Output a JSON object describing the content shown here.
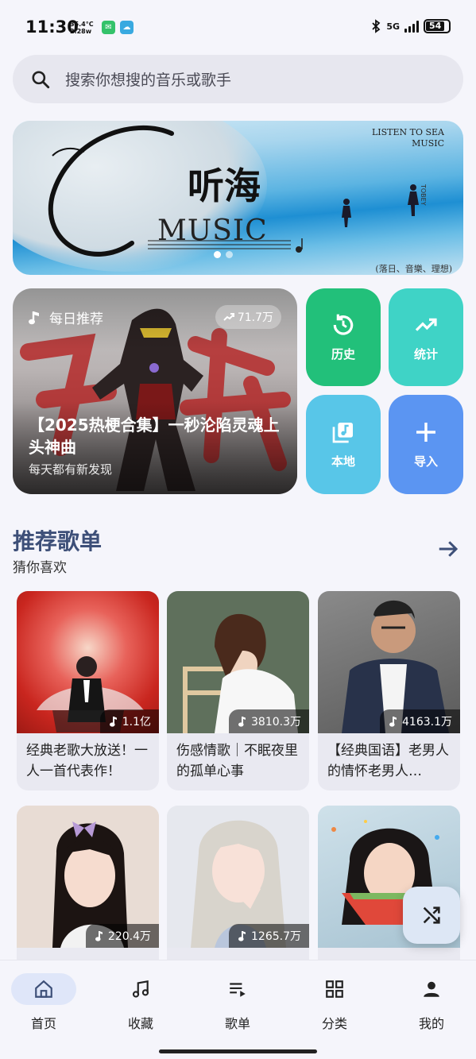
{
  "status_bar": {
    "time": "11:30",
    "temp": "35.4°C",
    "power": "2.28w",
    "network": "5G",
    "battery": "54"
  },
  "search": {
    "placeholder": "搜索你想搜的音乐或歌手"
  },
  "banner": {
    "top_text_1": "LISTEN TO SEA",
    "top_text_2": "MUSIC",
    "title": "听海",
    "music_word": "MUSIC",
    "vertical_text": "TOBEY",
    "footer_text": "(落日、音樂、理想)",
    "slide_count": 2,
    "active_slide": 1
  },
  "daily": {
    "label": "每日推荐",
    "plays": "71.7万",
    "title": "【2025热梗合集】一秒沦陷灵魂上头神曲",
    "subtitle": "每天都有新发现"
  },
  "quick_tiles": [
    {
      "label": "历史",
      "icon": "history-icon",
      "color": "#22c07a"
    },
    {
      "label": "统计",
      "icon": "trending-icon",
      "color": "#3fd3c6"
    },
    {
      "label": "本地",
      "icon": "music-library-icon",
      "color": "#58c6e8"
    },
    {
      "label": "导入",
      "icon": "plus-icon",
      "color": "#5b95f2"
    }
  ],
  "section": {
    "title": "推荐歌单",
    "subtitle": "猜你喜欢"
  },
  "playlists": [
    {
      "count": "1.1亿",
      "title": "经典老歌大放送！一人一首代表作！"
    },
    {
      "count": "3810.3万",
      "title": "伤感情歌｜不眠夜里的孤单心事"
    },
    {
      "count": "4163.1万",
      "title": "【经典国语】老男人的情怀老男人…"
    },
    {
      "count": "220.4万",
      "title": ""
    },
    {
      "count": "1265.7万",
      "title": ""
    },
    {
      "count": "",
      "title": ""
    }
  ],
  "nav": [
    {
      "label": "首页",
      "icon": "home-icon"
    },
    {
      "label": "收藏",
      "icon": "music-note-icon"
    },
    {
      "label": "歌单",
      "icon": "playlist-icon"
    },
    {
      "label": "分类",
      "icon": "grid-icon"
    },
    {
      "label": "我的",
      "icon": "person-icon"
    }
  ],
  "active_nav": 0
}
